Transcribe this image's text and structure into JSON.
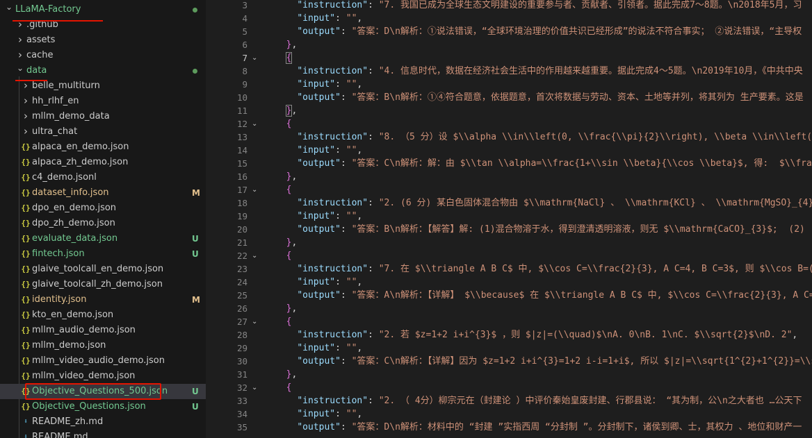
{
  "explorer": {
    "items": [
      {
        "label": "LLaMA-Factory",
        "level": 0,
        "type": "folder",
        "state": "expanded",
        "root": true,
        "status_dot": "#5d9b5d"
      },
      {
        "label": ".github",
        "level": 1,
        "type": "folder",
        "state": "collapsed"
      },
      {
        "label": "assets",
        "level": 1,
        "type": "folder",
        "state": "collapsed"
      },
      {
        "label": "cache",
        "level": 1,
        "type": "folder",
        "state": "collapsed"
      },
      {
        "label": "data",
        "level": 1,
        "type": "folder",
        "state": "expanded",
        "color": "#73c991",
        "status_dot": "#5d9b5d"
      },
      {
        "label": "belle_multiturn",
        "level": 2,
        "type": "folder",
        "state": "collapsed"
      },
      {
        "label": "hh_rlhf_en",
        "level": 2,
        "type": "folder",
        "state": "collapsed"
      },
      {
        "label": "mllm_demo_data",
        "level": 2,
        "type": "folder",
        "state": "collapsed"
      },
      {
        "label": "ultra_chat",
        "level": 2,
        "type": "folder",
        "state": "collapsed"
      },
      {
        "label": "alpaca_en_demo.json",
        "level": 2,
        "type": "json"
      },
      {
        "label": "alpaca_zh_demo.json",
        "level": 2,
        "type": "json"
      },
      {
        "label": "c4_demo.jsonl",
        "level": 2,
        "type": "json"
      },
      {
        "label": "dataset_info.json",
        "level": 2,
        "type": "json",
        "color": "#e2c08d",
        "badge": "M",
        "badge_color": "#e2c08d"
      },
      {
        "label": "dpo_en_demo.json",
        "level": 2,
        "type": "json"
      },
      {
        "label": "dpo_zh_demo.json",
        "level": 2,
        "type": "json"
      },
      {
        "label": "evaluate_data.json",
        "level": 2,
        "type": "json",
        "color": "#73c991",
        "badge": "U",
        "badge_color": "#73c991"
      },
      {
        "label": "fintech.json",
        "level": 2,
        "type": "json",
        "color": "#73c991",
        "badge": "U",
        "badge_color": "#73c991"
      },
      {
        "label": "glaive_toolcall_en_demo.json",
        "level": 2,
        "type": "json"
      },
      {
        "label": "glaive_toolcall_zh_demo.json",
        "level": 2,
        "type": "json"
      },
      {
        "label": "identity.json",
        "level": 2,
        "type": "json",
        "color": "#e2c08d",
        "badge": "M",
        "badge_color": "#e2c08d"
      },
      {
        "label": "kto_en_demo.json",
        "level": 2,
        "type": "json"
      },
      {
        "label": "mllm_audio_demo.json",
        "level": 2,
        "type": "json"
      },
      {
        "label": "mllm_demo.json",
        "level": 2,
        "type": "json"
      },
      {
        "label": "mllm_video_audio_demo.json",
        "level": 2,
        "type": "json"
      },
      {
        "label": "mllm_video_demo.json",
        "level": 2,
        "type": "json"
      },
      {
        "label": "Objective_Questions_500.json",
        "level": 2,
        "type": "json",
        "color": "#73c991",
        "badge": "U",
        "badge_color": "#73c991",
        "selected": true
      },
      {
        "label": "Objective_Questions.json",
        "level": 2,
        "type": "json",
        "color": "#73c991",
        "badge": "U",
        "badge_color": "#73c991"
      },
      {
        "label": "README_zh.md",
        "level": 2,
        "type": "md"
      },
      {
        "label": "README.md",
        "level": 2,
        "type": "md"
      }
    ]
  },
  "editor": {
    "lines": [
      {
        "n": "3",
        "fold": false,
        "tokens": [
          [
            "p",
            "    "
          ],
          [
            "k",
            "\"instruction\""
          ],
          [
            "p",
            ": "
          ],
          [
            "s",
            "\"7. 我国已成为全球生态文明建设的重要参与者、贡献者、引领者。据此完成7～8题。\\n2018年5月，习"
          ]
        ]
      },
      {
        "n": "4",
        "fold": false,
        "tokens": [
          [
            "p",
            "    "
          ],
          [
            "k",
            "\"input\""
          ],
          [
            "p",
            ": "
          ],
          [
            "s",
            "\"\""
          ],
          [
            "p",
            ","
          ]
        ]
      },
      {
        "n": "5",
        "fold": false,
        "tokens": [
          [
            "p",
            "    "
          ],
          [
            "k",
            "\"output\""
          ],
          [
            "p",
            ": "
          ],
          [
            "s",
            "\"答案：D\\n解析：①说法错误，“全球环境治理的价值共识已经形成”的说法不符合事实； ②说法错误，“主导权"
          ]
        ]
      },
      {
        "n": "6",
        "fold": false,
        "tokens": [
          [
            "p",
            "  "
          ],
          [
            "b1",
            "}"
          ],
          [
            "p",
            ","
          ]
        ]
      },
      {
        "n": "7",
        "fold": true,
        "active": true,
        "tokens": [
          [
            "p",
            "  "
          ],
          [
            "b1",
            "{"
          ]
        ],
        "match": true
      },
      {
        "n": "8",
        "fold": false,
        "tokens": [
          [
            "p",
            "    "
          ],
          [
            "k",
            "\"instruction\""
          ],
          [
            "p",
            ": "
          ],
          [
            "s",
            "\"4. 信息时代，数据在经济社会生活中的作用越来越重要。据此完成4～5题。\\n2019年10月，《中共中央"
          ]
        ]
      },
      {
        "n": "9",
        "fold": false,
        "tokens": [
          [
            "p",
            "    "
          ],
          [
            "k",
            "\"input\""
          ],
          [
            "p",
            ": "
          ],
          [
            "s",
            "\"\""
          ],
          [
            "p",
            ","
          ]
        ]
      },
      {
        "n": "10",
        "fold": false,
        "tokens": [
          [
            "p",
            "    "
          ],
          [
            "k",
            "\"output\""
          ],
          [
            "p",
            ": "
          ],
          [
            "s",
            "\"答案：B\\n解析：①④符合题意，依据题意，首次将数据与劳动、资本、土地等并列，将其列为 生产要素。这是"
          ]
        ]
      },
      {
        "n": "11",
        "fold": false,
        "tokens": [
          [
            "p",
            "  "
          ],
          [
            "b1",
            "}"
          ],
          [
            "p",
            ","
          ]
        ],
        "match": true
      },
      {
        "n": "12",
        "fold": true,
        "tokens": [
          [
            "p",
            "  "
          ],
          [
            "b1",
            "{"
          ]
        ]
      },
      {
        "n": "13",
        "fold": false,
        "tokens": [
          [
            "p",
            "    "
          ],
          [
            "k",
            "\"instruction\""
          ],
          [
            "p",
            ": "
          ],
          [
            "s",
            "\"8. （5 分）设 $\\\\alpha \\\\in\\\\left(0, \\\\frac{\\\\pi}{2}\\\\right), \\\\beta \\\\in\\\\left(0, \\\\"
          ]
        ]
      },
      {
        "n": "14",
        "fold": false,
        "tokens": [
          [
            "p",
            "    "
          ],
          [
            "k",
            "\"input\""
          ],
          [
            "p",
            ": "
          ],
          [
            "s",
            "\"\""
          ],
          [
            "p",
            ","
          ]
        ]
      },
      {
        "n": "15",
        "fold": false,
        "tokens": [
          [
            "p",
            "    "
          ],
          [
            "k",
            "\"output\""
          ],
          [
            "p",
            ": "
          ],
          [
            "s",
            "\"答案：C\\n解析：解：由 $\\\\tan \\\\alpha=\\\\frac{1+\\\\sin \\\\beta}{\\\\cos \\\\beta}$, 得:  $\\\\frac{1"
          ]
        ]
      },
      {
        "n": "16",
        "fold": false,
        "tokens": [
          [
            "p",
            "  "
          ],
          [
            "b1",
            "}"
          ],
          [
            "p",
            ","
          ]
        ]
      },
      {
        "n": "17",
        "fold": true,
        "tokens": [
          [
            "p",
            "  "
          ],
          [
            "b1",
            "{"
          ]
        ]
      },
      {
        "n": "18",
        "fold": false,
        "tokens": [
          [
            "p",
            "    "
          ],
          [
            "k",
            "\"instruction\""
          ],
          [
            "p",
            ": "
          ],
          [
            "s",
            "\"2. (6 分) 某白色固体混合物由 $\\\\mathrm{NaCl} 、 \\\\mathrm{KCl} 、 \\\\mathrm{MgSO}_{4} 、"
          ]
        ]
      },
      {
        "n": "19",
        "fold": false,
        "tokens": [
          [
            "p",
            "    "
          ],
          [
            "k",
            "\"input\""
          ],
          [
            "p",
            ": "
          ],
          [
            "s",
            "\"\""
          ],
          [
            "p",
            ","
          ]
        ]
      },
      {
        "n": "20",
        "fold": false,
        "tokens": [
          [
            "p",
            "    "
          ],
          [
            "k",
            "\"output\""
          ],
          [
            "p",
            ": "
          ],
          [
            "s",
            "\"答案：B\\n解析：【解答】解: (1)混合物溶于水，得到澄清透明溶液，则无 $\\\\mathrm{CaCO}_{3}$;  (2)"
          ]
        ]
      },
      {
        "n": "21",
        "fold": false,
        "tokens": [
          [
            "p",
            "  "
          ],
          [
            "b1",
            "}"
          ],
          [
            "p",
            ","
          ]
        ]
      },
      {
        "n": "22",
        "fold": true,
        "tokens": [
          [
            "p",
            "  "
          ],
          [
            "b1",
            "{"
          ]
        ]
      },
      {
        "n": "23",
        "fold": false,
        "tokens": [
          [
            "p",
            "    "
          ],
          [
            "k",
            "\"instruction\""
          ],
          [
            "p",
            ": "
          ],
          [
            "s",
            "\"7. 在 $\\\\triangle A B C$ 中, $\\\\cos C=\\\\frac{2}{3}, A C=4, B C=3$, 则 $\\\\cos B=(\\\\qu"
          ]
        ]
      },
      {
        "n": "24",
        "fold": false,
        "tokens": [
          [
            "p",
            "    "
          ],
          [
            "k",
            "\"input\""
          ],
          [
            "p",
            ": "
          ],
          [
            "s",
            "\"\""
          ],
          [
            "p",
            ","
          ]
        ]
      },
      {
        "n": "25",
        "fold": false,
        "tokens": [
          [
            "p",
            "    "
          ],
          [
            "k",
            "\"output\""
          ],
          [
            "p",
            ": "
          ],
          [
            "s",
            "\"答案：A\\n解析：【详解】 $\\\\because$ 在 $\\\\triangle A B C$ 中, $\\\\cos C=\\\\frac{2}{3}, A C=4,"
          ]
        ]
      },
      {
        "n": "26",
        "fold": false,
        "tokens": [
          [
            "p",
            "  "
          ],
          [
            "b1",
            "}"
          ],
          [
            "p",
            ","
          ]
        ]
      },
      {
        "n": "27",
        "fold": true,
        "tokens": [
          [
            "p",
            "  "
          ],
          [
            "b1",
            "{"
          ]
        ]
      },
      {
        "n": "28",
        "fold": false,
        "tokens": [
          [
            "p",
            "    "
          ],
          [
            "k",
            "\"instruction\""
          ],
          [
            "p",
            ": "
          ],
          [
            "s",
            "\"2. 若 $z=1+2 i+i^{3}$ ，则 $|z|=(\\\\quad)$\\nA. 0\\nB. 1\\nC. $\\\\sqrt{2}$\\nD. 2\""
          ],
          [
            "p",
            ","
          ]
        ]
      },
      {
        "n": "29",
        "fold": false,
        "tokens": [
          [
            "p",
            "    "
          ],
          [
            "k",
            "\"input\""
          ],
          [
            "p",
            ": "
          ],
          [
            "s",
            "\"\""
          ],
          [
            "p",
            ","
          ]
        ]
      },
      {
        "n": "30",
        "fold": false,
        "tokens": [
          [
            "p",
            "    "
          ],
          [
            "k",
            "\"output\""
          ],
          [
            "p",
            ": "
          ],
          [
            "s",
            "\"答案：C\\n解析：【详解】因为 $z=1+2 i+i^{3}=1+2 i-i=1+i$, 所以 $|z|=\\\\sqrt{1^{2}+1^{2}}=\\\\s"
          ]
        ]
      },
      {
        "n": "31",
        "fold": false,
        "tokens": [
          [
            "p",
            "  "
          ],
          [
            "b1",
            "}"
          ],
          [
            "p",
            ","
          ]
        ]
      },
      {
        "n": "32",
        "fold": true,
        "tokens": [
          [
            "p",
            "  "
          ],
          [
            "b1",
            "{"
          ]
        ]
      },
      {
        "n": "33",
        "fold": false,
        "tokens": [
          [
            "p",
            "    "
          ],
          [
            "k",
            "\"instruction\""
          ],
          [
            "p",
            ": "
          ],
          [
            "s",
            "\"2. （ 4分）柳宗元在（封建论 ）中评价秦始皇废封建、行郡县说： “其为制，公\\n之大者也 …公天下"
          ]
        ]
      },
      {
        "n": "34",
        "fold": false,
        "tokens": [
          [
            "p",
            "    "
          ],
          [
            "k",
            "\"input\""
          ],
          [
            "p",
            ": "
          ],
          [
            "s",
            "\"\""
          ],
          [
            "p",
            ","
          ]
        ]
      },
      {
        "n": "35",
        "fold": false,
        "tokens": [
          [
            "p",
            "    "
          ],
          [
            "k",
            "\"output\""
          ],
          [
            "p",
            ": "
          ],
          [
            "s",
            "\"答案：D\\n解析：材料中的 “封建 ”实指西周 “分封制 ”。分封制下，诸侯到卿、士，其权力 、地位和财产一"
          ]
        ]
      }
    ]
  },
  "icons": {
    "chevron_right": "›",
    "chevron_down": "⌄",
    "json_icon": "{}",
    "md_icon": "⬇"
  },
  "colors": {
    "sidebar_bg": "#181818",
    "editor_bg": "#1e1e1e",
    "untracked": "#73c991",
    "modified": "#e2c08d",
    "annotation": "#e51400"
  }
}
